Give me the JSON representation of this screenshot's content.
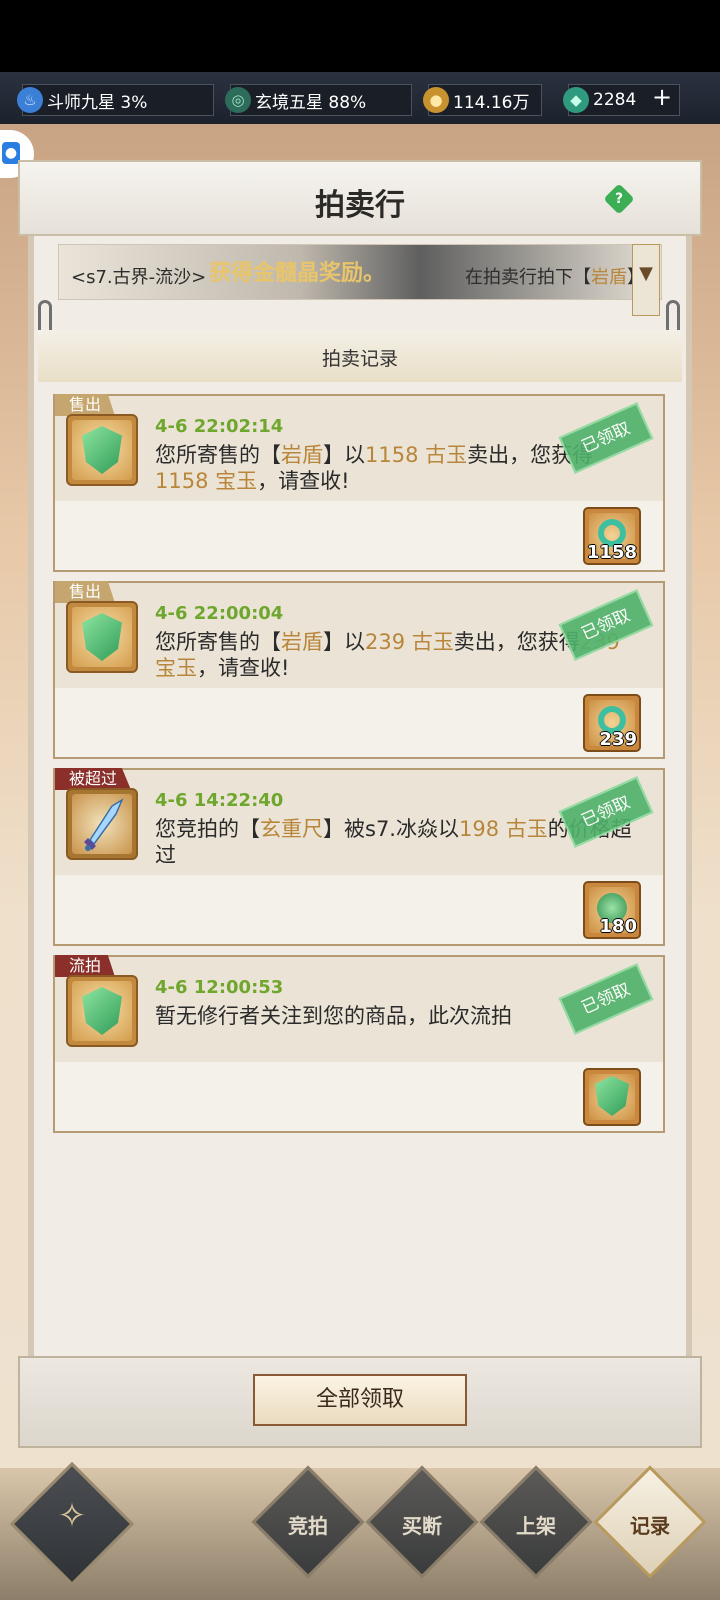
{
  "topbar": {
    "resources": [
      {
        "icon": "flame-icon",
        "text": "斗师九星 3%"
      },
      {
        "icon": "swirl-icon",
        "text": "玄境五星 88%"
      },
      {
        "icon": "gold-coin-icon",
        "text": "114.16万"
      },
      {
        "icon": "jade-icon",
        "text": "2284"
      }
    ],
    "plus_label": "+"
  },
  "header": {
    "title": "拍卖行",
    "help_label": "?"
  },
  "ticker": {
    "prefix": "<s7.古界-流沙>",
    "overlay": "获得金髓晶奖励。",
    "suffix_pre": "在拍卖行拍下【",
    "suffix_item": "岩盾",
    "suffix_post": "】",
    "dropdown": "▼"
  },
  "section": {
    "title": "拍卖记录"
  },
  "records": [
    {
      "tag": "售出",
      "time": "4-6 22:02:14",
      "msg_a": "您所寄售的【",
      "item": "岩盾",
      "msg_b": "】以",
      "price": "1158 古玉",
      "msg_c": "卖出，您获得",
      "gain": "1158 宝玉",
      "msg_d": "，请查收!",
      "stamp": "已领取",
      "reward_qty": "1158"
    },
    {
      "tag": "售出",
      "time": "4-6 22:00:04",
      "msg_a": "您所寄售的【",
      "item": "岩盾",
      "msg_b": "】以",
      "price": "239 古玉",
      "msg_c": "卖出，您获得",
      "gain": "239 宝玉",
      "msg_d": "，请查收!",
      "stamp": "已领取",
      "reward_qty": "239"
    },
    {
      "tag": "被超过",
      "time": "4-6 14:22:40",
      "msg_a": "您竞拍的【",
      "item": "玄重尺",
      "msg_b": "】被s7.冰焱以",
      "price": "198 古玉",
      "msg_c": "的价格超过",
      "stamp": "已领取",
      "reward_qty": "180"
    },
    {
      "tag": "流拍",
      "time": "4-6 12:00:53",
      "msg_a": "暂无修行者关注到您的商品，此次流拍",
      "stamp": "已领取"
    }
  ],
  "claim_all": "全部领取",
  "nav": {
    "tabs": [
      "竞拍",
      "买断",
      "上架",
      "记录"
    ],
    "active": "记录"
  }
}
